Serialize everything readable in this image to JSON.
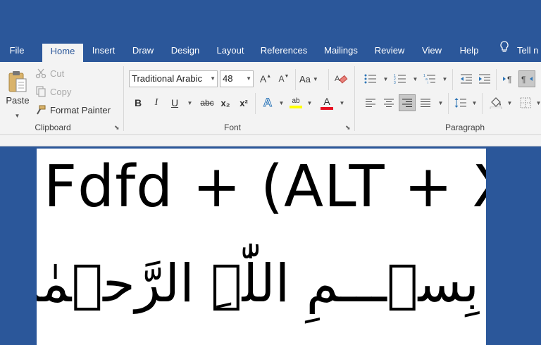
{
  "tabs": [
    {
      "label": "File"
    },
    {
      "label": "Home"
    },
    {
      "label": "Insert"
    },
    {
      "label": "Draw"
    },
    {
      "label": "Design"
    },
    {
      "label": "Layout"
    },
    {
      "label": "References"
    },
    {
      "label": "Mailings"
    },
    {
      "label": "Review"
    },
    {
      "label": "View"
    },
    {
      "label": "Help"
    }
  ],
  "tell_me": "Tell n",
  "clipboard": {
    "paste": "Paste",
    "cut": "Cut",
    "copy": "Copy",
    "format_painter": "Format Painter",
    "group_label": "Clipboard"
  },
  "font": {
    "font_name": "Traditional Arabic",
    "font_size": "48",
    "grow": "A",
    "shrink": "A",
    "change_case": "Aa",
    "bold": "B",
    "italic": "I",
    "underline": "U",
    "strikethrough": "abc",
    "subscript": "x₂",
    "superscript": "x²",
    "text_effects": "A",
    "highlight": "ab",
    "font_color": "A",
    "group_label": "Font"
  },
  "paragraph": {
    "group_label": "Paragraph"
  },
  "colors": {
    "brand": "#2b579a",
    "highlight": "#ffff00",
    "font_color": "#e81123"
  },
  "document": {
    "line1": "Fdfd + (ALT + X)",
    "line2": "بِسۡـــمِ اللّٰہِ الرَّحۡمٰنِ الرَّحِيۡــمِ"
  }
}
